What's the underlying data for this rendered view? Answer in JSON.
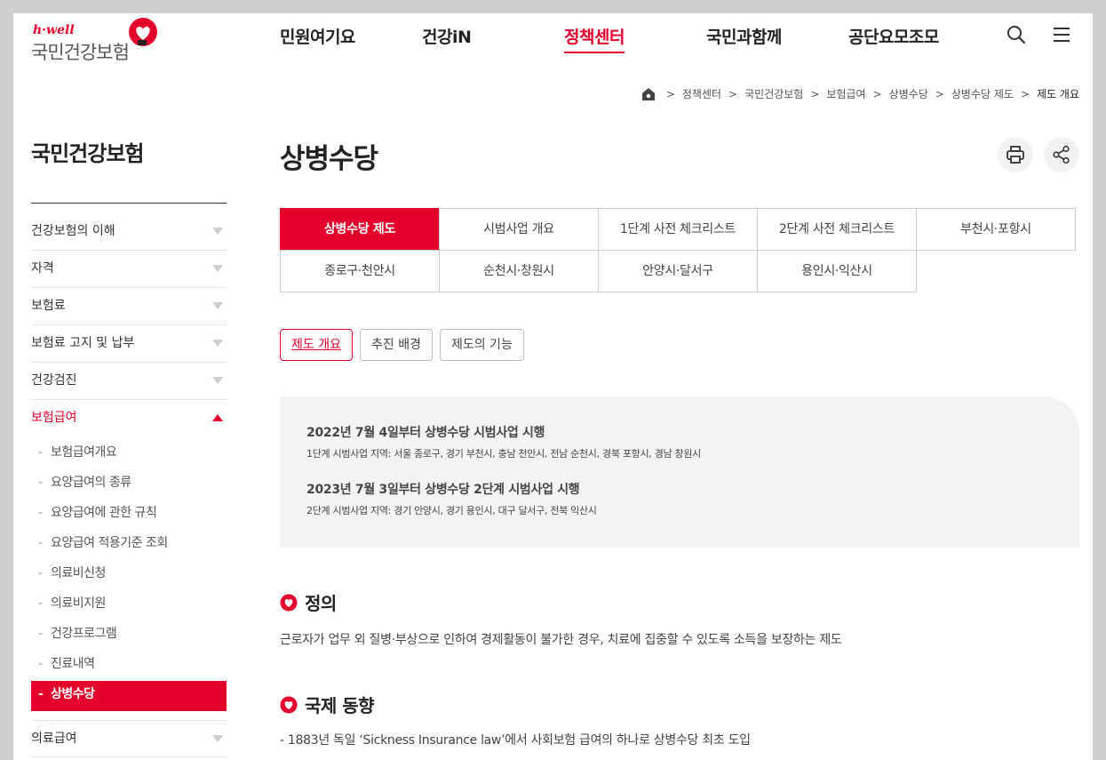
{
  "header": {
    "logo_tagline": "h·well",
    "logo_name": "국민건강보험",
    "nav": [
      "민원여기요",
      "건강iN",
      "정책센터",
      "국민과함께",
      "공단요모조모"
    ],
    "active_nav": "정책센터"
  },
  "breadcrumb": [
    "정책센터",
    "국민건강보험",
    "보험급여",
    "상병수당",
    "상병수당 제도",
    "제도 개요"
  ],
  "sidebar": {
    "title": "국민건강보험",
    "items": [
      "건강보험의 이해",
      "자격",
      "보험료",
      "보험료 고지 및 납부",
      "건강검진",
      "보험급여"
    ],
    "open_item": "보험급여",
    "sub_items": [
      "보험급여개요",
      "요양급여의 종류",
      "요양급여에 관한 규칙",
      "요양급여 적용기준 조회",
      "의료비신청",
      "의료비지원",
      "건강프로그램",
      "진료내역",
      "상병수당"
    ],
    "active_sub": "상병수당",
    "after_items": [
      "의료급여"
    ]
  },
  "page": {
    "title": "상병수당",
    "tabs": [
      "상병수당 제도",
      "시범사업 개요",
      "1단계 사전 체크리스트",
      "2단계 사전 체크리스트",
      "부천시·포항시",
      "종로구·천안시",
      "순천시·창원시",
      "안양시·달서구",
      "용인시·익산시"
    ],
    "active_tab": "상병수당 제도",
    "subtabs": [
      "제도 개요",
      "추진 배경",
      "제도의 기능"
    ],
    "active_subtab": "제도 개요",
    "info": [
      {
        "head": "2022년 7월 4일부터 상병수당 시범사업 시행",
        "sub": "1단계 시범사업 지역: 서울 종로구, 경기 부천시, 충남 천안시, 전남 순천시, 경북 포항시, 경남 창원시"
      },
      {
        "head": "2023년 7월 3일부터 상병수당 2단계 시범사업 시행",
        "sub": "2단계 시범사업 지역: 경기 안양시, 경기 용인시, 대구 달서구, 전북 익산시"
      }
    ],
    "sections": [
      {
        "title": "정의",
        "text": "근로자가 업무 외 질병·부상으로 인하여 경제활동이 불가한 경우, 치료에 집중할 수 있도록 소득을 보장하는 제도"
      },
      {
        "title": "국제 동향",
        "text": "- 1883년 독일 ‘Sickness Insurance law’에서 사회보험 급여의 하나로 상병수당 최초 도입"
      }
    ]
  },
  "colors": {
    "accent": "#e4002b",
    "box_bg": "#f3f3f3"
  },
  "icons": {
    "search": "search-icon",
    "menu": "hamburger-icon",
    "print": "print-icon",
    "share": "share-icon",
    "home": "home-icon"
  }
}
